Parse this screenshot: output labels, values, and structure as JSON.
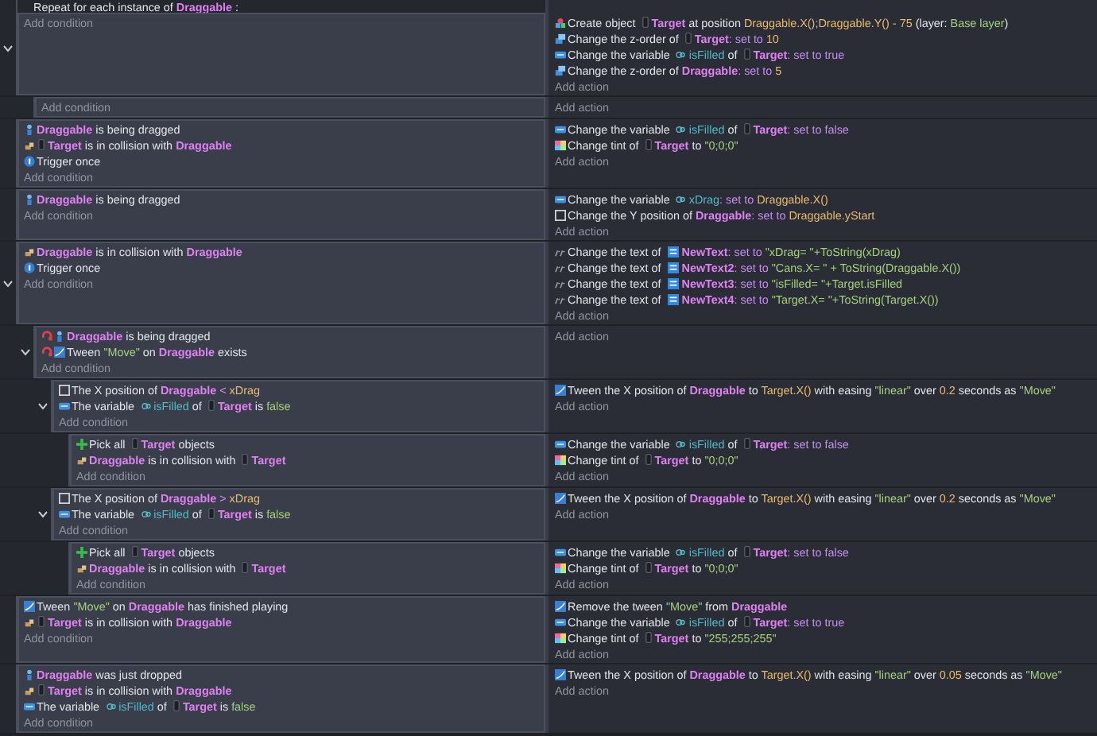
{
  "events": [
    {
      "kind": "repeat",
      "expanded": true,
      "header": [
        {
          "t": "Repeat for each instance of ",
          "kind": "text"
        },
        {
          "t": "Draggable",
          "kind": "obj"
        },
        {
          "t": " :",
          "kind": "text"
        }
      ],
      "add_condition": "Add condition",
      "add_action": "Add action",
      "actions": [
        {
          "kind": "create",
          "parts": [
            {
              "t": "Create object ",
              "kind": "text"
            },
            {
              "t": "Target",
              "kind": "obj_box"
            },
            {
              "t": " at position ",
              "kind": "text"
            },
            {
              "t": "Draggable.X();Draggable.Y() - 75",
              "kind": "val"
            },
            {
              "t": " (layer: ",
              "kind": "text"
            },
            {
              "t": "Base layer",
              "kind": "str"
            },
            {
              "t": ")",
              "kind": "text"
            }
          ]
        },
        {
          "kind": "zorder",
          "parts": [
            {
              "t": "Change the z-order of ",
              "kind": "text"
            },
            {
              "t": "Target",
              "kind": "obj_box"
            },
            {
              "t": ": set to ",
              "kind": "op"
            },
            {
              "t": "10",
              "kind": "val"
            }
          ]
        },
        {
          "kind": "variable",
          "parts": [
            {
              "t": "Change the variable ",
              "kind": "text"
            },
            {
              "t": "isFilled",
              "kind": "var"
            },
            {
              "t": " of ",
              "kind": "text"
            },
            {
              "t": "Target",
              "kind": "obj_box"
            },
            {
              "t": ": set to true",
              "kind": "op"
            }
          ]
        },
        {
          "kind": "zorder",
          "parts": [
            {
              "t": "Change the z-order of ",
              "kind": "text"
            },
            {
              "t": "Draggable",
              "kind": "obj"
            },
            {
              "t": ": set to ",
              "kind": "op"
            },
            {
              "t": "5",
              "kind": "val"
            }
          ]
        }
      ],
      "children": [
        {
          "kind": "standard",
          "add_condition": "Add condition",
          "add_action": "Add action"
        }
      ]
    },
    {
      "kind": "standard",
      "add_condition": "Add condition",
      "add_action": "Add action",
      "conditions": [
        {
          "kind": "drag",
          "inverted": false,
          "parts": [
            {
              "t": "Draggable",
              "kind": "obj"
            },
            {
              "t": " is being dragged",
              "kind": "text"
            }
          ]
        },
        {
          "kind": "collision",
          "inverted": false,
          "parts": [
            {
              "t": "Target",
              "kind": "obj_box"
            },
            {
              "t": " is in collision with ",
              "kind": "text"
            },
            {
              "t": "Draggable",
              "kind": "obj"
            }
          ]
        },
        {
          "kind": "once",
          "inverted": false,
          "parts": [
            {
              "t": "Trigger once",
              "kind": "text"
            }
          ]
        }
      ],
      "actions": [
        {
          "kind": "variable",
          "parts": [
            {
              "t": "Change the variable ",
              "kind": "text"
            },
            {
              "t": "isFilled",
              "kind": "var"
            },
            {
              "t": " of ",
              "kind": "text"
            },
            {
              "t": "Target",
              "kind": "obj_box"
            },
            {
              "t": ": set to false",
              "kind": "op"
            }
          ]
        },
        {
          "kind": "tint",
          "parts": [
            {
              "t": "Change tint of ",
              "kind": "text"
            },
            {
              "t": "Target",
              "kind": "obj_box"
            },
            {
              "t": " to ",
              "kind": "text"
            },
            {
              "t": "\"0;0;0\"",
              "kind": "str"
            }
          ]
        }
      ]
    },
    {
      "kind": "standard",
      "add_condition": "Add condition",
      "add_action": "Add action",
      "conditions": [
        {
          "kind": "drag",
          "inverted": false,
          "parts": [
            {
              "t": "Draggable",
              "kind": "obj"
            },
            {
              "t": " is being dragged",
              "kind": "text"
            }
          ]
        }
      ],
      "actions": [
        {
          "kind": "variable",
          "parts": [
            {
              "t": "Change the variable ",
              "kind": "text"
            },
            {
              "t": "xDrag",
              "kind": "var"
            },
            {
              "t": ": set to ",
              "kind": "op"
            },
            {
              "t": "Draggable.X()",
              "kind": "val"
            }
          ]
        },
        {
          "kind": "position",
          "parts": [
            {
              "t": "Change the Y position of ",
              "kind": "text"
            },
            {
              "t": "Draggable",
              "kind": "obj"
            },
            {
              "t": ": set to ",
              "kind": "op"
            },
            {
              "t": "Draggable.yStart",
              "kind": "val"
            }
          ]
        }
      ]
    },
    {
      "kind": "standard",
      "expanded": true,
      "add_condition": "Add condition",
      "add_action": "Add action",
      "conditions": [
        {
          "kind": "collision",
          "inverted": false,
          "parts": [
            {
              "t": "Draggable",
              "kind": "obj"
            },
            {
              "t": " is in collision with ",
              "kind": "text"
            },
            {
              "t": "Draggable",
              "kind": "obj"
            }
          ]
        },
        {
          "kind": "once",
          "inverted": false,
          "parts": [
            {
              "t": "Trigger once",
              "kind": "text"
            }
          ]
        }
      ],
      "actions": [
        {
          "kind": "text",
          "parts": [
            {
              "t": "Change the text of ",
              "kind": "text"
            },
            {
              "t": "NewText",
              "kind": "obj_text"
            },
            {
              "t": ": set to ",
              "kind": "op"
            },
            {
              "t": "\"xDrag= \"+ToString(xDrag)",
              "kind": "str"
            }
          ]
        },
        {
          "kind": "text",
          "parts": [
            {
              "t": "Change the text of ",
              "kind": "text"
            },
            {
              "t": "NewText2",
              "kind": "obj_text"
            },
            {
              "t": ": set to ",
              "kind": "op"
            },
            {
              "t": "\"Cans.X= \" + ToString(Draggable.X())",
              "kind": "str"
            }
          ]
        },
        {
          "kind": "text",
          "parts": [
            {
              "t": "Change the text of ",
              "kind": "text"
            },
            {
              "t": "NewText3",
              "kind": "obj_text"
            },
            {
              "t": ": set to ",
              "kind": "op"
            },
            {
              "t": "\"isFilled= \"+Target.isFilled",
              "kind": "str"
            }
          ]
        },
        {
          "kind": "text",
          "parts": [
            {
              "t": "Change the text of ",
              "kind": "text"
            },
            {
              "t": "NewText4",
              "kind": "obj_text"
            },
            {
              "t": ": set to ",
              "kind": "op"
            },
            {
              "t": "\"Target.X= \"+ToString(Target.X())",
              "kind": "str"
            }
          ]
        }
      ],
      "children": [
        {
          "kind": "standard",
          "expanded": true,
          "add_condition": "Add condition",
          "add_action": "Add action",
          "conditions": [
            {
              "kind": "drag",
              "inverted": true,
              "parts": [
                {
                  "t": "Draggable",
                  "kind": "obj"
                },
                {
                  "t": " is being dragged",
                  "kind": "text"
                }
              ]
            },
            {
              "kind": "tween",
              "inverted": true,
              "parts": [
                {
                  "t": "Tween ",
                  "kind": "text"
                },
                {
                  "t": "\"Move\"",
                  "kind": "str"
                },
                {
                  "t": " on ",
                  "kind": "text"
                },
                {
                  "t": "Draggable",
                  "kind": "obj"
                },
                {
                  "t": " exists",
                  "kind": "text"
                }
              ]
            }
          ],
          "children": [
            {
              "kind": "standard",
              "expanded": true,
              "add_condition": "Add condition",
              "add_action": "Add action",
              "conditions": [
                {
                  "kind": "position",
                  "inverted": false,
                  "parts": [
                    {
                      "t": "The X position of ",
                      "kind": "text"
                    },
                    {
                      "t": "Draggable",
                      "kind": "obj"
                    },
                    {
                      "t": " < ",
                      "kind": "op"
                    },
                    {
                      "t": "xDrag",
                      "kind": "val"
                    }
                  ]
                },
                {
                  "kind": "variable",
                  "inverted": false,
                  "parts": [
                    {
                      "t": "The variable ",
                      "kind": "text"
                    },
                    {
                      "t": "isFilled",
                      "kind": "var"
                    },
                    {
                      "t": " of ",
                      "kind": "text"
                    },
                    {
                      "t": "Target",
                      "kind": "obj_box"
                    },
                    {
                      "t": " is ",
                      "kind": "text"
                    },
                    {
                      "t": "false",
                      "kind": "bool"
                    }
                  ]
                }
              ],
              "actions": [
                {
                  "kind": "tween",
                  "parts": [
                    {
                      "t": "Tween the X position of ",
                      "kind": "text"
                    },
                    {
                      "t": "Draggable",
                      "kind": "obj"
                    },
                    {
                      "t": " to ",
                      "kind": "text"
                    },
                    {
                      "t": "Target.X()",
                      "kind": "val"
                    },
                    {
                      "t": " with easing ",
                      "kind": "text"
                    },
                    {
                      "t": "\"linear\"",
                      "kind": "str"
                    },
                    {
                      "t": " over ",
                      "kind": "text"
                    },
                    {
                      "t": "0.2",
                      "kind": "val"
                    },
                    {
                      "t": " seconds as ",
                      "kind": "text"
                    },
                    {
                      "t": "\"Move\"",
                      "kind": "str"
                    }
                  ]
                }
              ],
              "children": [
                {
                  "kind": "standard",
                  "add_condition": "Add condition",
                  "add_action": "Add action",
                  "conditions": [
                    {
                      "kind": "pick",
                      "inverted": false,
                      "parts": [
                        {
                          "t": "Pick all ",
                          "kind": "text"
                        },
                        {
                          "t": "Target",
                          "kind": "obj_box"
                        },
                        {
                          "t": " objects",
                          "kind": "text"
                        }
                      ]
                    },
                    {
                      "kind": "collision",
                      "inverted": false,
                      "parts": [
                        {
                          "t": "Draggable",
                          "kind": "obj"
                        },
                        {
                          "t": " is in collision with ",
                          "kind": "text"
                        },
                        {
                          "t": "Target",
                          "kind": "obj_box"
                        }
                      ]
                    }
                  ],
                  "actions": [
                    {
                      "kind": "variable",
                      "parts": [
                        {
                          "t": "Change the variable ",
                          "kind": "text"
                        },
                        {
                          "t": "isFilled",
                          "kind": "var"
                        },
                        {
                          "t": " of ",
                          "kind": "text"
                        },
                        {
                          "t": "Target",
                          "kind": "obj_box"
                        },
                        {
                          "t": ": set to false",
                          "kind": "op"
                        }
                      ]
                    },
                    {
                      "kind": "tint",
                      "parts": [
                        {
                          "t": "Change tint of ",
                          "kind": "text"
                        },
                        {
                          "t": "Target",
                          "kind": "obj_box"
                        },
                        {
                          "t": " to ",
                          "kind": "text"
                        },
                        {
                          "t": "\"0;0;0\"",
                          "kind": "str"
                        }
                      ]
                    }
                  ]
                }
              ]
            },
            {
              "kind": "standard",
              "expanded": true,
              "add_condition": "Add condition",
              "add_action": "Add action",
              "conditions": [
                {
                  "kind": "position",
                  "inverted": false,
                  "parts": [
                    {
                      "t": "The X position of ",
                      "kind": "text"
                    },
                    {
                      "t": "Draggable",
                      "kind": "obj"
                    },
                    {
                      "t": " > ",
                      "kind": "op"
                    },
                    {
                      "t": "xDrag",
                      "kind": "val"
                    }
                  ]
                },
                {
                  "kind": "variable",
                  "inverted": false,
                  "parts": [
                    {
                      "t": "The variable ",
                      "kind": "text"
                    },
                    {
                      "t": "isFilled",
                      "kind": "var"
                    },
                    {
                      "t": " of ",
                      "kind": "text"
                    },
                    {
                      "t": "Target",
                      "kind": "obj_box"
                    },
                    {
                      "t": " is ",
                      "kind": "text"
                    },
                    {
                      "t": "false",
                      "kind": "bool"
                    }
                  ]
                }
              ],
              "actions": [
                {
                  "kind": "tween",
                  "parts": [
                    {
                      "t": "Tween the X position of ",
                      "kind": "text"
                    },
                    {
                      "t": "Draggable",
                      "kind": "obj"
                    },
                    {
                      "t": " to ",
                      "kind": "text"
                    },
                    {
                      "t": "Target.X()",
                      "kind": "val"
                    },
                    {
                      "t": " with easing ",
                      "kind": "text"
                    },
                    {
                      "t": "\"linear\"",
                      "kind": "str"
                    },
                    {
                      "t": " over ",
                      "kind": "text"
                    },
                    {
                      "t": "0.2",
                      "kind": "val"
                    },
                    {
                      "t": " seconds as ",
                      "kind": "text"
                    },
                    {
                      "t": "\"Move\"",
                      "kind": "str"
                    }
                  ]
                }
              ],
              "children": [
                {
                  "kind": "standard",
                  "add_condition": "Add condition",
                  "add_action": "Add action",
                  "conditions": [
                    {
                      "kind": "pick",
                      "inverted": false,
                      "parts": [
                        {
                          "t": "Pick all ",
                          "kind": "text"
                        },
                        {
                          "t": "Target",
                          "kind": "obj_box"
                        },
                        {
                          "t": " objects",
                          "kind": "text"
                        }
                      ]
                    },
                    {
                      "kind": "collision",
                      "inverted": false,
                      "parts": [
                        {
                          "t": "Draggable",
                          "kind": "obj"
                        },
                        {
                          "t": " is in collision with ",
                          "kind": "text"
                        },
                        {
                          "t": "Target",
                          "kind": "obj_box"
                        }
                      ]
                    }
                  ],
                  "actions": [
                    {
                      "kind": "variable",
                      "parts": [
                        {
                          "t": "Change the variable ",
                          "kind": "text"
                        },
                        {
                          "t": "isFilled",
                          "kind": "var"
                        },
                        {
                          "t": " of ",
                          "kind": "text"
                        },
                        {
                          "t": "Target",
                          "kind": "obj_box"
                        },
                        {
                          "t": ": set to false",
                          "kind": "op"
                        }
                      ]
                    },
                    {
                      "kind": "tint",
                      "parts": [
                        {
                          "t": "Change tint of ",
                          "kind": "text"
                        },
                        {
                          "t": "Target",
                          "kind": "obj_box"
                        },
                        {
                          "t": " to ",
                          "kind": "text"
                        },
                        {
                          "t": "\"0;0;0\"",
                          "kind": "str"
                        }
                      ]
                    }
                  ]
                }
              ]
            }
          ]
        }
      ]
    },
    {
      "kind": "standard",
      "add_condition": "Add condition",
      "add_action": "Add action",
      "conditions": [
        {
          "kind": "tween",
          "inverted": false,
          "parts": [
            {
              "t": "Tween ",
              "kind": "text"
            },
            {
              "t": "\"Move\"",
              "kind": "str"
            },
            {
              "t": " on ",
              "kind": "text"
            },
            {
              "t": "Draggable",
              "kind": "obj"
            },
            {
              "t": " has finished playing",
              "kind": "text"
            }
          ]
        },
        {
          "kind": "collision",
          "inverted": false,
          "parts": [
            {
              "t": "Target",
              "kind": "obj_box"
            },
            {
              "t": " is in collision with ",
              "kind": "text"
            },
            {
              "t": "Draggable",
              "kind": "obj"
            }
          ]
        }
      ],
      "actions": [
        {
          "kind": "tween",
          "parts": [
            {
              "t": "Remove the tween ",
              "kind": "text"
            },
            {
              "t": "\"Move\"",
              "kind": "str"
            },
            {
              "t": " from ",
              "kind": "text"
            },
            {
              "t": "Draggable",
              "kind": "obj"
            }
          ]
        },
        {
          "kind": "variable",
          "parts": [
            {
              "t": "Change the variable ",
              "kind": "text"
            },
            {
              "t": "isFilled",
              "kind": "var"
            },
            {
              "t": " of ",
              "kind": "text"
            },
            {
              "t": "Target",
              "kind": "obj_box"
            },
            {
              "t": ": set to true",
              "kind": "op"
            }
          ]
        },
        {
          "kind": "tint",
          "parts": [
            {
              "t": "Change tint of ",
              "kind": "text"
            },
            {
              "t": "Target",
              "kind": "obj_box"
            },
            {
              "t": " to ",
              "kind": "text"
            },
            {
              "t": "\"255;255;255\"",
              "kind": "str"
            }
          ]
        }
      ]
    },
    {
      "kind": "standard",
      "add_condition": "Add condition",
      "add_action": "Add action",
      "conditions": [
        {
          "kind": "drag",
          "inverted": false,
          "parts": [
            {
              "t": "Draggable",
              "kind": "obj"
            },
            {
              "t": " was just dropped",
              "kind": "text"
            }
          ]
        },
        {
          "kind": "collision",
          "inverted": false,
          "parts": [
            {
              "t": "Target",
              "kind": "obj_box"
            },
            {
              "t": " is in collision with ",
              "kind": "text"
            },
            {
              "t": "Draggable",
              "kind": "obj"
            }
          ]
        },
        {
          "kind": "variable",
          "inverted": false,
          "parts": [
            {
              "t": "The variable ",
              "kind": "text"
            },
            {
              "t": "isFilled",
              "kind": "var"
            },
            {
              "t": " of ",
              "kind": "text"
            },
            {
              "t": "Target",
              "kind": "obj_box"
            },
            {
              "t": " is ",
              "kind": "text"
            },
            {
              "t": "false",
              "kind": "bool"
            }
          ]
        }
      ],
      "actions": [
        {
          "kind": "tween",
          "parts": [
            {
              "t": "Tween the X position of ",
              "kind": "text"
            },
            {
              "t": "Draggable",
              "kind": "obj"
            },
            {
              "t": " to ",
              "kind": "text"
            },
            {
              "t": "Target.X()",
              "kind": "val"
            },
            {
              "t": " with easing ",
              "kind": "text"
            },
            {
              "t": "\"linear\"",
              "kind": "str"
            },
            {
              "t": " over ",
              "kind": "text"
            },
            {
              "t": "0.05",
              "kind": "val"
            },
            {
              "t": " seconds as ",
              "kind": "text"
            },
            {
              "t": "\"Move\"",
              "kind": "str"
            }
          ]
        }
      ]
    }
  ]
}
